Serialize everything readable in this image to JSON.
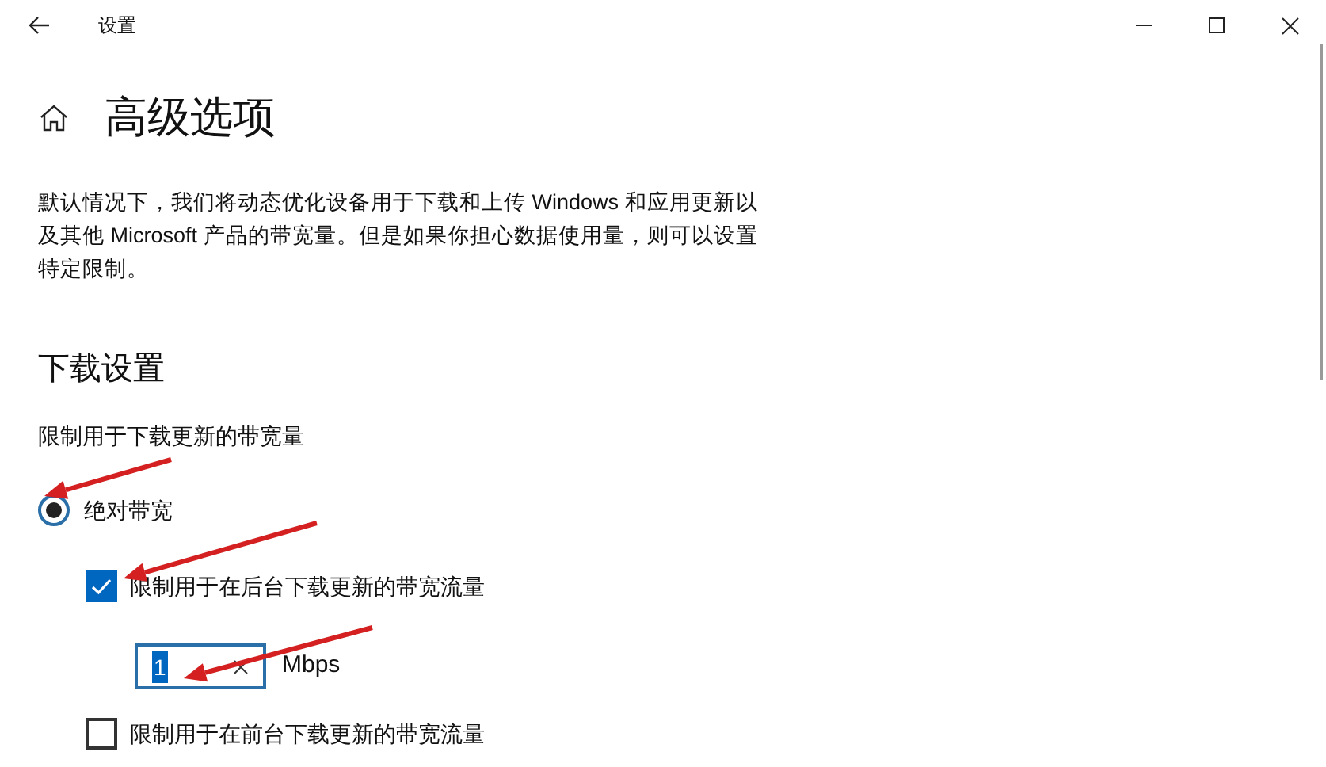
{
  "window": {
    "title": "设置"
  },
  "page": {
    "title": "高级选项",
    "description": "默认情况下，我们将动态优化设备用于下载和上传 Windows 和应用更新以及其他 Microsoft 产品的带宽量。但是如果你担心数据使用量，则可以设置特定限制。"
  },
  "download_settings": {
    "heading": "下载设置",
    "label": "限制用于下载更新的带宽量",
    "radio": {
      "label": "绝对带宽",
      "selected": true
    },
    "options": [
      {
        "kind": "checkbox",
        "label": "限制用于在后台下载更新的带宽流量",
        "checked": true
      },
      {
        "kind": "field",
        "value": "1",
        "unit": "Mbps"
      },
      {
        "kind": "checkbox",
        "label": "限制用于在前台下载更新的带宽流量",
        "checked": false
      }
    ]
  }
}
